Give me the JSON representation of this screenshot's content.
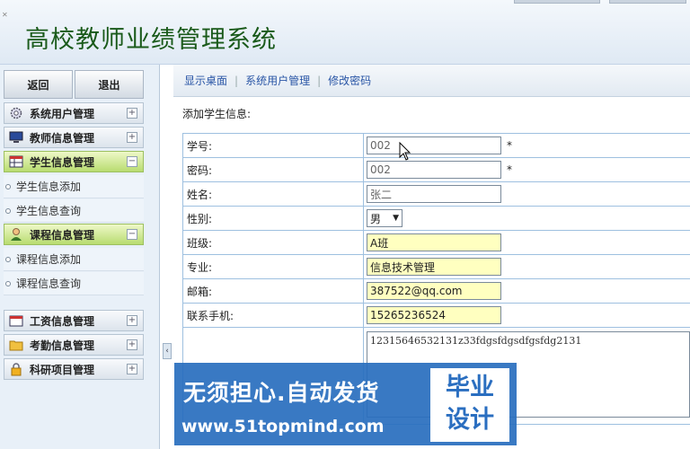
{
  "header": {
    "title": "高校教师业绩管理系统"
  },
  "sidebar": {
    "back_label": "返回",
    "logout_label": "退出",
    "groups": [
      {
        "label": "系统用户管理",
        "icon": "gear-icon",
        "expanded": false
      },
      {
        "label": "教师信息管理",
        "icon": "monitor-icon",
        "expanded": false
      },
      {
        "label": "学生信息管理",
        "icon": "table-icon",
        "expanded": true,
        "items": [
          "学生信息添加",
          "学生信息查询"
        ]
      },
      {
        "label": "课程信息管理",
        "icon": "person-icon",
        "expanded": true,
        "items": [
          "课程信息添加",
          "课程信息查询"
        ]
      },
      {
        "label": "工资信息管理",
        "icon": "calendar-icon",
        "expanded": false
      },
      {
        "label": "考勤信息管理",
        "icon": "folder-icon",
        "expanded": false
      },
      {
        "label": "科研项目管理",
        "icon": "lock-icon",
        "expanded": false
      }
    ]
  },
  "nav": {
    "links": [
      "显示桌面",
      "系统用户管理",
      "修改密码"
    ]
  },
  "form": {
    "title": "添加学生信息:",
    "fields": [
      {
        "label": "学号:",
        "value": "002",
        "required": true
      },
      {
        "label": "密码:",
        "value": "002",
        "required": true
      },
      {
        "label": "姓名:",
        "value": "张二"
      },
      {
        "label": "性别:",
        "value": "男"
      },
      {
        "label": "班级:",
        "value": "A班"
      },
      {
        "label": "专业:",
        "value": "信息技术管理"
      },
      {
        "label": "邮箱:",
        "value": "387522@qq.com"
      },
      {
        "label": "联系手机:",
        "value": "15265236524"
      }
    ],
    "notes_value": "12315646532131z33fdgsfdgsdfgsfdg2131",
    "required_mark": "*"
  },
  "watermark": {
    "line1": "无须担心.自动发货",
    "line2": "www.51topmind.com",
    "badge_line1": "毕业",
    "badge_line2": "设计"
  },
  "colors": {
    "title": "#1a5a1a",
    "active_group": "#b8dc70",
    "link": "#2a56a6",
    "input_highlight": "#ffffc0"
  }
}
